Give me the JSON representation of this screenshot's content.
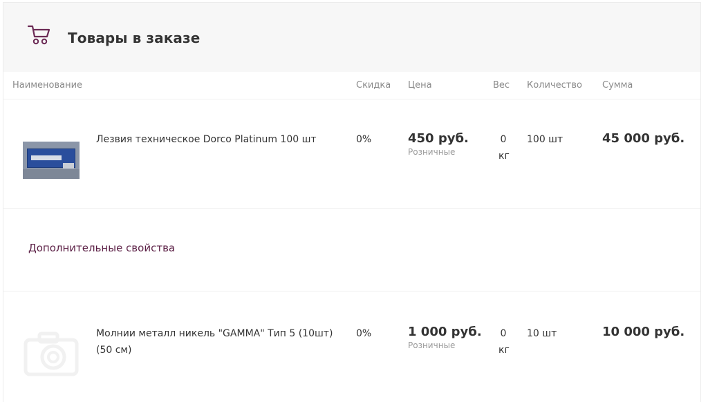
{
  "header": {
    "title": "Товары в заказе",
    "icon": "cart-icon",
    "accent_color": "#6b2a55"
  },
  "columns": {
    "name": "Наименование",
    "discount": "Скидка",
    "price": "Цена",
    "weight": "Вес",
    "quantity": "Количество",
    "sum": "Сумма"
  },
  "items": [
    {
      "name": "Лезвия техническое Dorco Platinum 100 шт",
      "discount": "0%",
      "price": "450 руб.",
      "price_type": "Розничные",
      "weight_value": "0",
      "weight_unit": "кг",
      "quantity": "100 шт",
      "sum": "45 000 руб."
    },
    {
      "name": "Молнии металл никель \"GAMMA\" Тип 5 (10шт) (50 см)",
      "discount": "0%",
      "price": "1 000 руб.",
      "price_type": "Розничные",
      "weight_value": "0",
      "weight_unit": "кг",
      "quantity": "10 шт",
      "sum": "10 000 руб."
    }
  ],
  "properties": {
    "label": "Дополнительные свойства"
  }
}
